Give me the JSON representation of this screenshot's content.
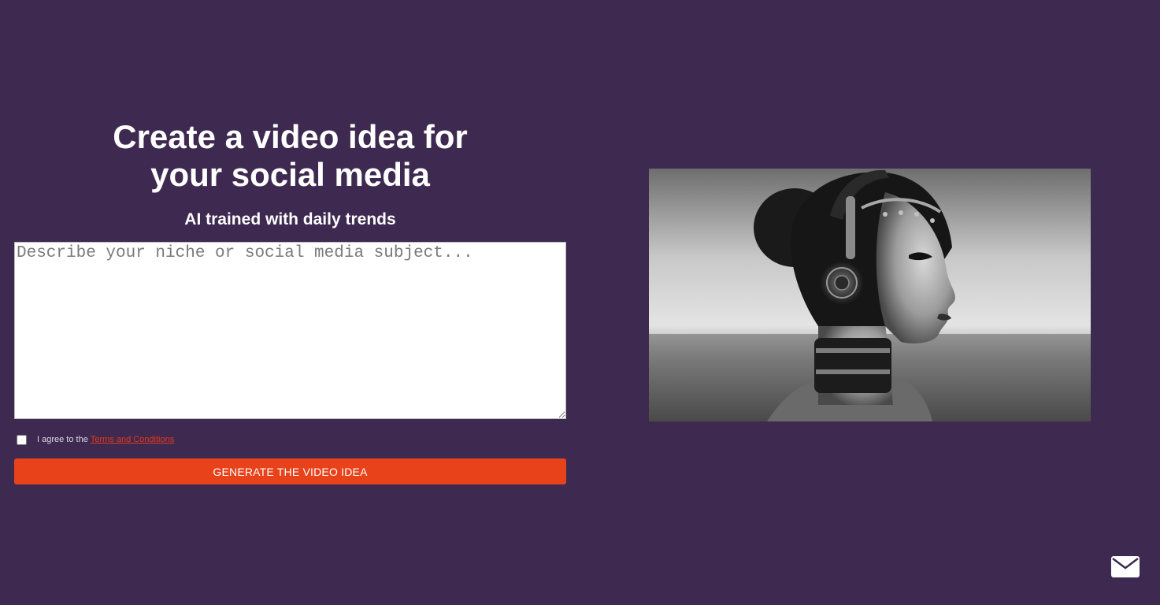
{
  "hero": {
    "headline_line1": "Create a video idea for",
    "headline_line2": "your social media",
    "subheadline": "AI trained with daily trends"
  },
  "form": {
    "textarea_placeholder": "Describe your niche or social media subject...",
    "textarea_value": "",
    "terms_checked": false,
    "terms_prefix": "I agree to the",
    "terms_link": "Terms and Conditions",
    "generate_label": "GENERATE THE VIDEO IDEA"
  },
  "illustration": {
    "icon": "woman-with-headphones-image"
  },
  "contact": {
    "icon": "mail-icon"
  },
  "colors": {
    "background": "#3e2a50",
    "accent": "#e8421b",
    "link": "#e8361b",
    "text": "#ffffff"
  }
}
